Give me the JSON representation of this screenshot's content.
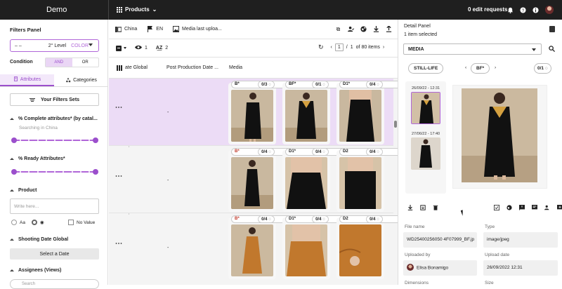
{
  "app": {
    "title": "Demo",
    "section": "Products",
    "edit_requests": "0 edit requests"
  },
  "colors": {
    "accent": "#9b4fcc",
    "topbar": "#1f1f1f",
    "selected_row": "#ecdcf6"
  },
  "left_panel": {
    "title": "Filters Panel",
    "level_select": {
      "dash": "– –",
      "level": "2° Level",
      "color": "COLOR"
    },
    "condition": {
      "label": "Condition",
      "and": "AND",
      "or": "OR"
    },
    "tabs": [
      {
        "label": "Attributes",
        "icon": "attributes-icon"
      },
      {
        "label": "Categories",
        "icon": "categories-icon"
      }
    ],
    "filters_sets": "Your Filters Sets",
    "complete_attr": {
      "label": "% Complete attributes* (by catal...",
      "sub": "Searching in China"
    },
    "ready_attr": {
      "label": "% Ready Attributes*"
    },
    "product": {
      "label": "Product",
      "placeholder": "Write here...",
      "option_aa": "Aa",
      "no_value": "No Value"
    },
    "shooting": {
      "label": "Shooting Date Global",
      "button": "Select a Date"
    },
    "assignees": {
      "label": "Assignees (Views)",
      "search_placeholder": "Search"
    }
  },
  "toolbar": {
    "country": "China",
    "language": "EN",
    "media": "Media last uploa...",
    "views_count": "1",
    "sort_count": "2"
  },
  "pager": {
    "current": "1",
    "total": "1",
    "items": "of 80 items"
  },
  "columns": {
    "c1": "ate Global",
    "c2": "Post Production Date ...",
    "c3": "Media"
  },
  "rows": [
    {
      "dash": "-",
      "cards": [
        {
          "tag": "B*",
          "red": false,
          "count": "0/3"
        },
        {
          "tag": "BF*",
          "red": false,
          "count": "0/1"
        },
        {
          "tag": "D1*",
          "red": false,
          "count": "0/4"
        }
      ]
    },
    {
      "dash": "-",
      "cards": [
        {
          "tag": "B*",
          "red": true,
          "count": "0/4"
        },
        {
          "tag": "D1*",
          "red": false,
          "count": "0/4"
        },
        {
          "tag": "D2",
          "red": false,
          "count": "0/4"
        }
      ]
    },
    {
      "dash": "-",
      "cards": [
        {
          "tag": "B*",
          "red": true,
          "count": "0/4"
        },
        {
          "tag": "D1*",
          "red": false,
          "count": "0/4"
        },
        {
          "tag": "D2",
          "red": false,
          "count": "0/4"
        }
      ]
    }
  ],
  "detail": {
    "title": "Detail Panel",
    "subtitle": "1 item selected",
    "media_select": "MEDIA",
    "still_life": "STILL-LIFE",
    "shot_tag": "BF*",
    "count": "0/1",
    "thumb1_date": "26/09/22 - 12:31",
    "thumb2_date": "27/06/22 - 17:40",
    "file_name_label": "File name",
    "file_name": "WD25400256050 4F07999_BF.jp",
    "type_label": "Type",
    "type": "image/jpeg",
    "uploaded_by_label": "Uploaded by",
    "uploaded_by": "Elisa Bonamigo",
    "upload_date_label": "Upload date",
    "upload_date": "26/09/2022 12:31",
    "dimensions_label": "Dimensions",
    "size_label": "Size"
  }
}
